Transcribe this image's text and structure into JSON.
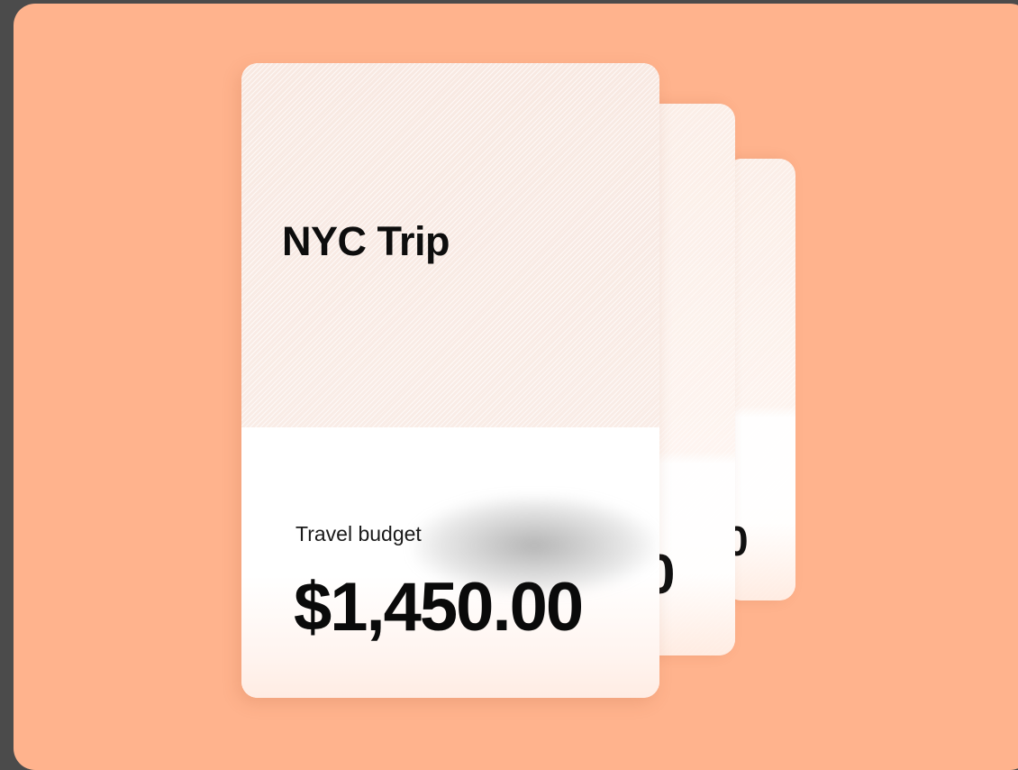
{
  "cards": [
    {
      "title": "NYC Trip",
      "label": "Travel budget",
      "amount": "$1,450.00"
    },
    {
      "amount_fragment": "0"
    },
    {
      "amount_fragment": "0"
    }
  ],
  "colors": {
    "background": "#ffb38d",
    "frame": "#4b4b4b",
    "card": "#fdf3ee",
    "text": "#0d0d0d"
  }
}
